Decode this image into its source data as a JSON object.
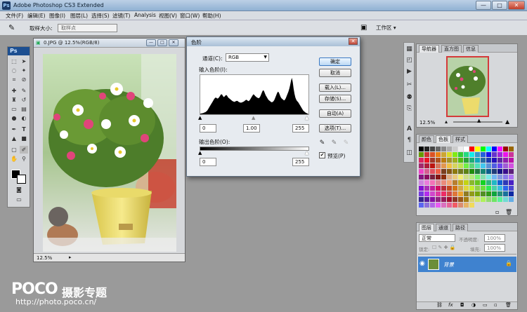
{
  "window": {
    "title": "Adobe Photoshop CS3 Extended",
    "ps_logo": "Ps",
    "minimize": "—",
    "maximize": "□",
    "close": "✕"
  },
  "menu": [
    "文件(F)",
    "编辑(E)",
    "图像(I)",
    "图层(L)",
    "选择(S)",
    "滤镜(T)",
    "Analysis",
    "视图(V)",
    "窗口(W)",
    "帮助(H)"
  ],
  "options": {
    "sample_label": "取样大小:",
    "sample_value": "取样点",
    "workspace": "工作区 ▾"
  },
  "tools": {
    "badge": "Ps"
  },
  "document": {
    "title": "0.JPG @ 12.5%(RGB/8)",
    "zoom": "12.5%"
  },
  "levels": {
    "title": "色阶",
    "channel_label": "通道(C):",
    "channel_value": "RGB",
    "input_label": "输入色阶(I):",
    "input_values": [
      "0",
      "1.00",
      "255"
    ],
    "output_label": "输出色阶(O):",
    "output_values": [
      "0",
      "255"
    ],
    "buttons": {
      "ok": "确定",
      "cancel": "取消",
      "load": "载入(L)...",
      "save": "存储(S)...",
      "auto": "自动(A)",
      "options": "选项(T)..."
    },
    "preview_label": "预览(P)",
    "preview_checked": true,
    "histogram": [
      2,
      2,
      3,
      3,
      4,
      5,
      6,
      8,
      10,
      14,
      18,
      22,
      26,
      30,
      34,
      38,
      42,
      45,
      46,
      44,
      43,
      45,
      48,
      52,
      55,
      54,
      50,
      47,
      49,
      52,
      53,
      50,
      46,
      44,
      42,
      40,
      38,
      36,
      35,
      34,
      35,
      36,
      37,
      36,
      34,
      33,
      32,
      32,
      33,
      34,
      35,
      37,
      39,
      40,
      38,
      36,
      37,
      40,
      44,
      48,
      52,
      55,
      53,
      50,
      48,
      46,
      45,
      44,
      46,
      50,
      56,
      62,
      66,
      64,
      58,
      52,
      48,
      44,
      40,
      38,
      36,
      34,
      33,
      34,
      36,
      40,
      46,
      52,
      58,
      62,
      60,
      54,
      48,
      44,
      42,
      40,
      38,
      40,
      44,
      50,
      56,
      62,
      70,
      80,
      92,
      100,
      88,
      70,
      56,
      46,
      40,
      36,
      34,
      30,
      26,
      22,
      18,
      14,
      10,
      8,
      6,
      4,
      3,
      2
    ]
  },
  "nav_panel": {
    "tabs": [
      "导航器",
      "直方图",
      "信息"
    ],
    "zoom": "12.5%"
  },
  "color_panel": {
    "tabs": [
      "颜色",
      "色板",
      "样式"
    ]
  },
  "layers_panel": {
    "tabs": [
      "图层",
      "通道",
      "路径"
    ],
    "blend_mode": "正常",
    "opacity_label": "不透明度:",
    "opacity": "100%",
    "lock_label": "锁定:",
    "fill_label": "填充:",
    "fill": "100%",
    "layer_name": "背景"
  },
  "watermark": {
    "logo": "POCO",
    "cn": "摄影专题",
    "url": "http://photo.poco.cn/"
  },
  "colors": {
    "accent": "#3f82cf",
    "title_bar": "#9fbcd9",
    "dialog_bg": "#e7ebf0"
  }
}
